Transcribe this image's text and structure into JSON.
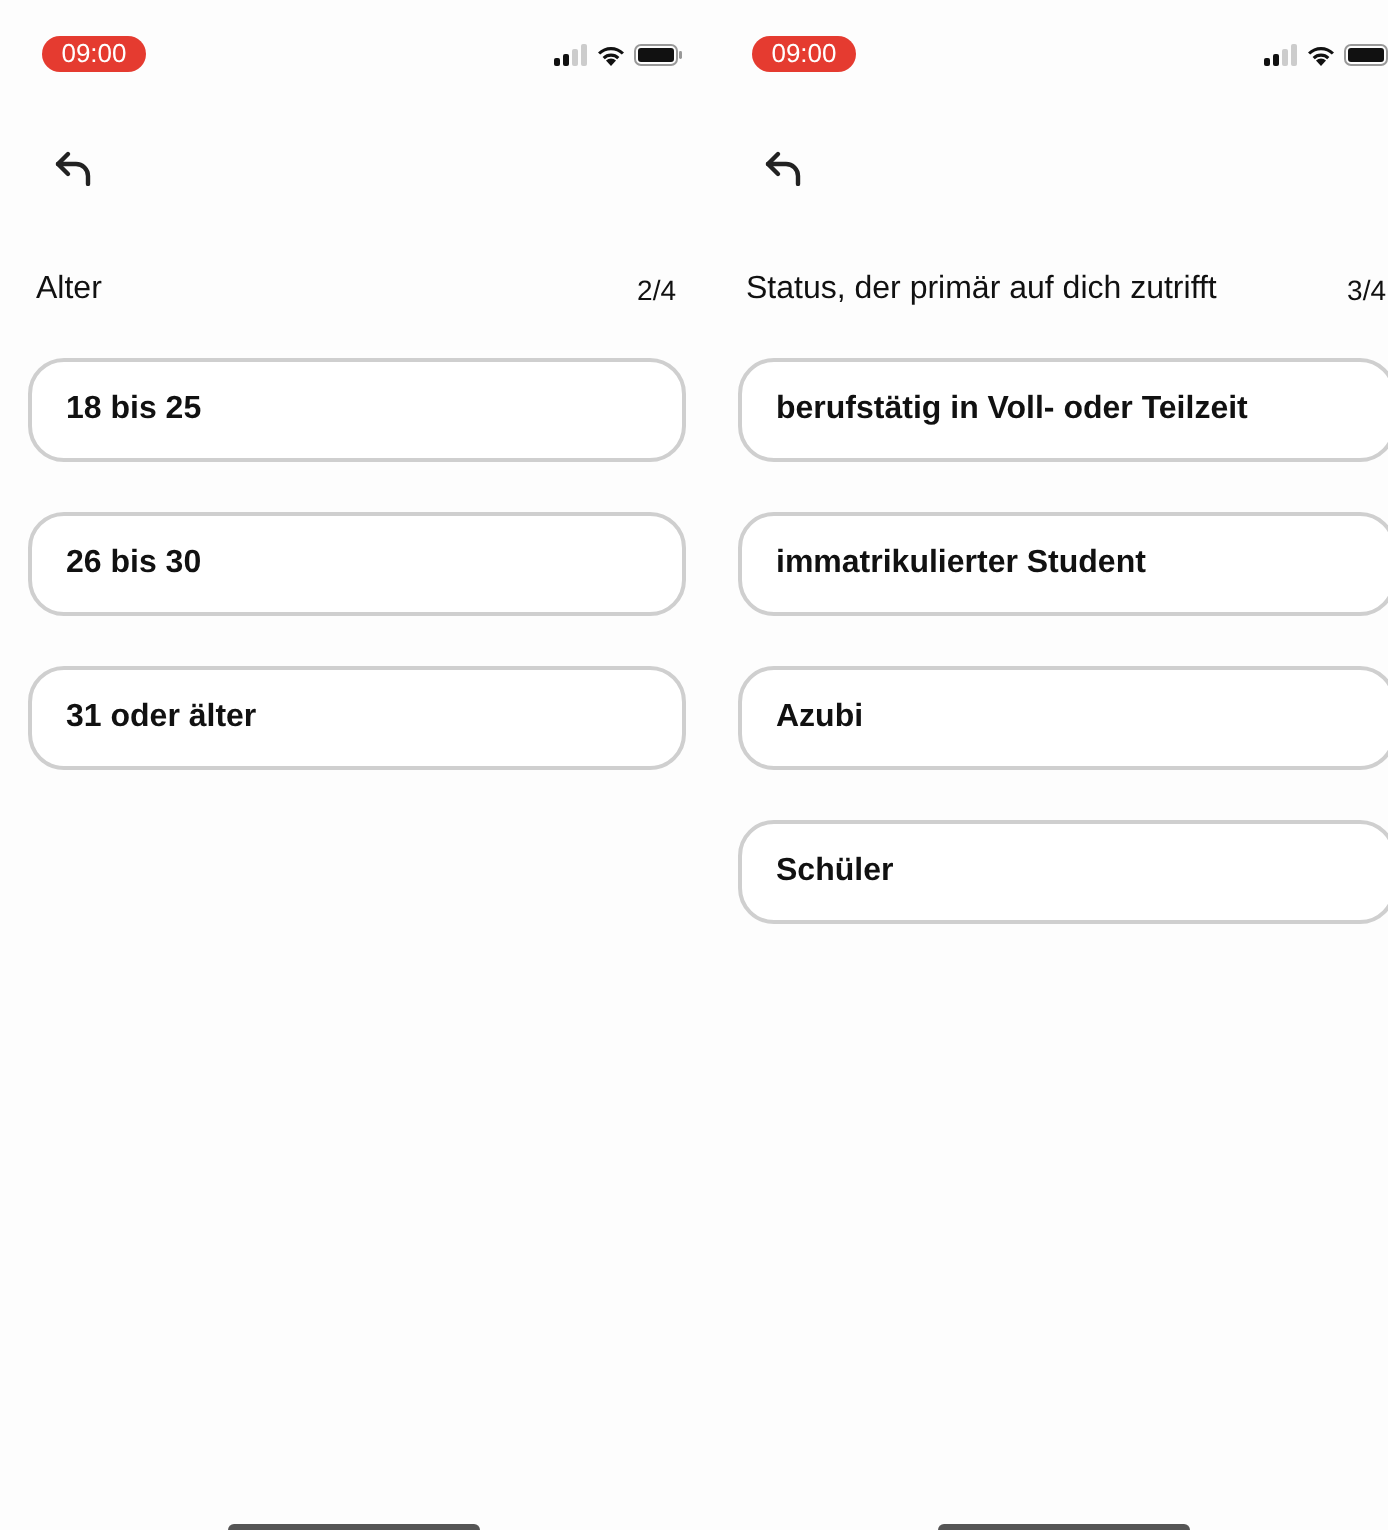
{
  "screens": [
    {
      "status_time": "09:00",
      "title": "Alter",
      "progress": "2/4",
      "options": [
        {
          "label": "18 bis 25"
        },
        {
          "label": "26 bis 30"
        },
        {
          "label": "31 oder älter"
        }
      ]
    },
    {
      "status_time": "09:00",
      "title": "Status, der primär auf dich zutrifft",
      "progress": "3/4",
      "options": [
        {
          "label": "berufstätig in Voll- oder Teilzeit"
        },
        {
          "label": "immatrikulierter Student"
        },
        {
          "label": "Azubi"
        },
        {
          "label": "Schüler"
        }
      ]
    }
  ]
}
